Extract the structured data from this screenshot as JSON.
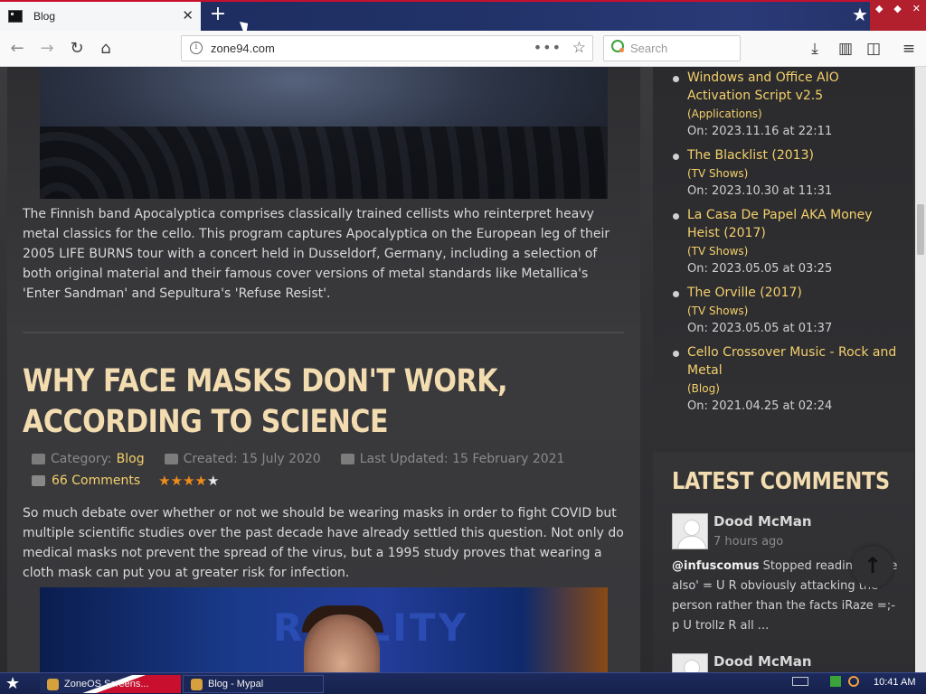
{
  "browser": {
    "tab_title": "Blog",
    "close_glyph": "✕",
    "newtab_glyph": "+",
    "url": "zone94.com",
    "url_actions": "•••",
    "search_placeholder": "Search",
    "icons": [
      "back-icon",
      "forward-icon",
      "reload-icon",
      "home-icon",
      "info-icon",
      "page-actions-icon",
      "bookmark-star-icon",
      "download-icon",
      "library-icon",
      "sidebar-icon",
      "menu-icon"
    ]
  },
  "article1": {
    "paragraph": "The Finnish band Apocalyptica comprises classically trained cellists who reinterpret heavy metal classics for the cello. This program captures Apocalyptica on the European leg of their 2005 LIFE BURNS tour with a concert held in Dusseldorf, Germany, including a selection of both original material and their famous cover versions of metal standards like Metallica's 'Enter Sandman' and Sepultura's 'Refuse Resist'."
  },
  "article2": {
    "title": "WHY FACE MASKS DON'T WORK, ACCORDING TO SCIENCE",
    "category_label": "Category:",
    "category_value": "Blog",
    "created": "Created: 15 July 2020",
    "updated": "Last Updated: 15 February 2021",
    "comments": "66 Comments",
    "rating": 4,
    "rating_max": 5,
    "paragraph": "So much debate over whether or not we should be wearing masks in order to fight COVID but multiple scientific studies over the past decade have already settled this question. Not only do medical masks not prevent the spread of the virus, but a 1995 study proves that wearing a cloth mask can put you at greater risk for infection.",
    "image_text": "REALITY"
  },
  "sidebar": {
    "recent_items": [
      {
        "title": "Windows and Office AIO Activation Script v2.5",
        "category": "(Applications)",
        "date": "On: 2023.11.16 at 22:11"
      },
      {
        "title": "The Blacklist (2013)",
        "category": "(TV Shows)",
        "date": "On: 2023.10.30 at 11:31"
      },
      {
        "title": "La Casa De Papel AKA Money Heist (2017)",
        "category": "(TV Shows)",
        "date": "On: 2023.05.05 at 03:25"
      },
      {
        "title": "The Orville (2017)",
        "category": "(TV Shows)",
        "date": "On: 2023.05.05 at 01:37"
      },
      {
        "title": "Cello Crossover Music - Rock and Metal",
        "category": "(Blog)",
        "date": "On: 2021.04.25 at 02:24"
      }
    ],
    "comments_heading": "LATEST COMMENTS",
    "comments": [
      {
        "author": "Dood McMan",
        "ago": "7 hours ago",
        "mention": "@infuscomus",
        "text": " Stopped reading at 'he also' = U R obviously attacking the person rather than the facts iRaze =;-p  U trollz R all ..."
      },
      {
        "author": "Dood McMan"
      }
    ]
  },
  "taskbar": {
    "task1": "ZoneOS Screens...",
    "task2": "Blog - Mypal",
    "clock": "10:41 AM"
  },
  "colors": {
    "accent_link": "#f4d06a",
    "heading": "#f3ddb0",
    "star_on": "#f08c1a",
    "star_off": "#e8e8e8",
    "window_close": "#b21f2d"
  }
}
